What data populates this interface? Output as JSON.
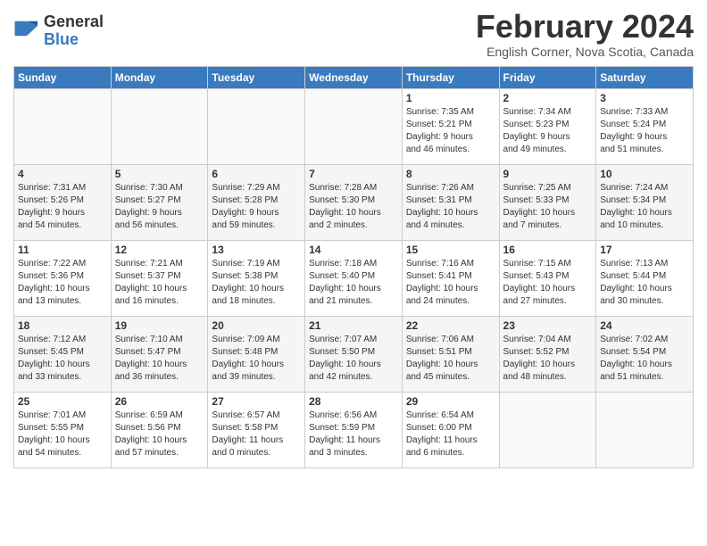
{
  "logo": {
    "line1": "General",
    "line2": "Blue"
  },
  "title": "February 2024",
  "subtitle": "English Corner, Nova Scotia, Canada",
  "days_of_week": [
    "Sunday",
    "Monday",
    "Tuesday",
    "Wednesday",
    "Thursday",
    "Friday",
    "Saturday"
  ],
  "weeks": [
    [
      {
        "day": "",
        "info": ""
      },
      {
        "day": "",
        "info": ""
      },
      {
        "day": "",
        "info": ""
      },
      {
        "day": "",
        "info": ""
      },
      {
        "day": "1",
        "info": "Sunrise: 7:35 AM\nSunset: 5:21 PM\nDaylight: 9 hours\nand 46 minutes."
      },
      {
        "day": "2",
        "info": "Sunrise: 7:34 AM\nSunset: 5:23 PM\nDaylight: 9 hours\nand 49 minutes."
      },
      {
        "day": "3",
        "info": "Sunrise: 7:33 AM\nSunset: 5:24 PM\nDaylight: 9 hours\nand 51 minutes."
      }
    ],
    [
      {
        "day": "4",
        "info": "Sunrise: 7:31 AM\nSunset: 5:26 PM\nDaylight: 9 hours\nand 54 minutes."
      },
      {
        "day": "5",
        "info": "Sunrise: 7:30 AM\nSunset: 5:27 PM\nDaylight: 9 hours\nand 56 minutes."
      },
      {
        "day": "6",
        "info": "Sunrise: 7:29 AM\nSunset: 5:28 PM\nDaylight: 9 hours\nand 59 minutes."
      },
      {
        "day": "7",
        "info": "Sunrise: 7:28 AM\nSunset: 5:30 PM\nDaylight: 10 hours\nand 2 minutes."
      },
      {
        "day": "8",
        "info": "Sunrise: 7:26 AM\nSunset: 5:31 PM\nDaylight: 10 hours\nand 4 minutes."
      },
      {
        "day": "9",
        "info": "Sunrise: 7:25 AM\nSunset: 5:33 PM\nDaylight: 10 hours\nand 7 minutes."
      },
      {
        "day": "10",
        "info": "Sunrise: 7:24 AM\nSunset: 5:34 PM\nDaylight: 10 hours\nand 10 minutes."
      }
    ],
    [
      {
        "day": "11",
        "info": "Sunrise: 7:22 AM\nSunset: 5:36 PM\nDaylight: 10 hours\nand 13 minutes."
      },
      {
        "day": "12",
        "info": "Sunrise: 7:21 AM\nSunset: 5:37 PM\nDaylight: 10 hours\nand 16 minutes."
      },
      {
        "day": "13",
        "info": "Sunrise: 7:19 AM\nSunset: 5:38 PM\nDaylight: 10 hours\nand 18 minutes."
      },
      {
        "day": "14",
        "info": "Sunrise: 7:18 AM\nSunset: 5:40 PM\nDaylight: 10 hours\nand 21 minutes."
      },
      {
        "day": "15",
        "info": "Sunrise: 7:16 AM\nSunset: 5:41 PM\nDaylight: 10 hours\nand 24 minutes."
      },
      {
        "day": "16",
        "info": "Sunrise: 7:15 AM\nSunset: 5:43 PM\nDaylight: 10 hours\nand 27 minutes."
      },
      {
        "day": "17",
        "info": "Sunrise: 7:13 AM\nSunset: 5:44 PM\nDaylight: 10 hours\nand 30 minutes."
      }
    ],
    [
      {
        "day": "18",
        "info": "Sunrise: 7:12 AM\nSunset: 5:45 PM\nDaylight: 10 hours\nand 33 minutes."
      },
      {
        "day": "19",
        "info": "Sunrise: 7:10 AM\nSunset: 5:47 PM\nDaylight: 10 hours\nand 36 minutes."
      },
      {
        "day": "20",
        "info": "Sunrise: 7:09 AM\nSunset: 5:48 PM\nDaylight: 10 hours\nand 39 minutes."
      },
      {
        "day": "21",
        "info": "Sunrise: 7:07 AM\nSunset: 5:50 PM\nDaylight: 10 hours\nand 42 minutes."
      },
      {
        "day": "22",
        "info": "Sunrise: 7:06 AM\nSunset: 5:51 PM\nDaylight: 10 hours\nand 45 minutes."
      },
      {
        "day": "23",
        "info": "Sunrise: 7:04 AM\nSunset: 5:52 PM\nDaylight: 10 hours\nand 48 minutes."
      },
      {
        "day": "24",
        "info": "Sunrise: 7:02 AM\nSunset: 5:54 PM\nDaylight: 10 hours\nand 51 minutes."
      }
    ],
    [
      {
        "day": "25",
        "info": "Sunrise: 7:01 AM\nSunset: 5:55 PM\nDaylight: 10 hours\nand 54 minutes."
      },
      {
        "day": "26",
        "info": "Sunrise: 6:59 AM\nSunset: 5:56 PM\nDaylight: 10 hours\nand 57 minutes."
      },
      {
        "day": "27",
        "info": "Sunrise: 6:57 AM\nSunset: 5:58 PM\nDaylight: 11 hours\nand 0 minutes."
      },
      {
        "day": "28",
        "info": "Sunrise: 6:56 AM\nSunset: 5:59 PM\nDaylight: 11 hours\nand 3 minutes."
      },
      {
        "day": "29",
        "info": "Sunrise: 6:54 AM\nSunset: 6:00 PM\nDaylight: 11 hours\nand 6 minutes."
      },
      {
        "day": "",
        "info": ""
      },
      {
        "day": "",
        "info": ""
      }
    ]
  ]
}
